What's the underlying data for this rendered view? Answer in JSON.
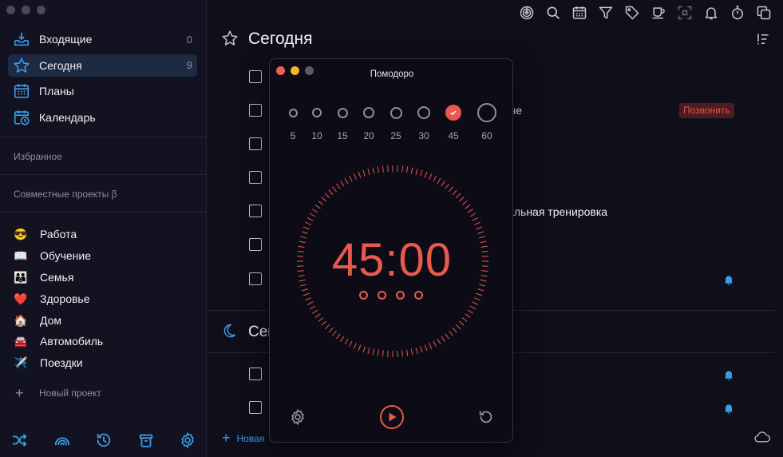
{
  "sidebar": {
    "nav": [
      {
        "icon": "inbox-icon",
        "label": "Входящие",
        "count": "0"
      },
      {
        "icon": "star-icon",
        "label": "Сегодня",
        "count": "9"
      },
      {
        "icon": "calendar-grid-icon",
        "label": "Планы",
        "count": ""
      },
      {
        "icon": "calendar-clock-icon",
        "label": "Календарь",
        "count": ""
      }
    ],
    "favorites_label": "Избранное",
    "shared_label": "Совместные проекты β",
    "projects": [
      {
        "emoji": "😎",
        "label": "Работа"
      },
      {
        "emoji": "📖",
        "label": "Обучение"
      },
      {
        "emoji": "👪",
        "label": "Семья"
      },
      {
        "emoji": "❤️",
        "label": "Здоровье"
      },
      {
        "emoji": "🏠",
        "label": "Дом"
      },
      {
        "emoji": "🚘",
        "label": "Автомобиль"
      },
      {
        "emoji": "✈️",
        "label": "Поездки"
      }
    ],
    "new_project_label": "Новый проект",
    "accent_color": "#3a9be6"
  },
  "main": {
    "title": "Сегодня",
    "tasks": [
      {
        "text": "",
        "tag": "",
        "bell": false
      },
      {
        "text": "че",
        "tag": "Позвонить",
        "bell": false
      },
      {
        "text": "",
        "tag": "",
        "bell": false
      },
      {
        "text": "",
        "tag": "",
        "bell": false
      },
      {
        "text": "рвальная тренировка",
        "tag": "",
        "bell": false
      },
      {
        "text": "",
        "tag": "",
        "bell": false
      },
      {
        "text": "",
        "tag": "",
        "bell": true
      }
    ],
    "evening_title": "Сег",
    "evening_tasks": [
      {
        "text": "",
        "bell": true
      },
      {
        "text": "",
        "bell": true
      }
    ],
    "new_task_label": "Новая"
  },
  "pomodoro": {
    "title": "Помодоро",
    "durations": [
      "5",
      "10",
      "15",
      "20",
      "25",
      "30",
      "45",
      "60"
    ],
    "selected_duration": "45",
    "time": "45:00",
    "rounds": 4,
    "accent_color": "#e85a4e"
  }
}
